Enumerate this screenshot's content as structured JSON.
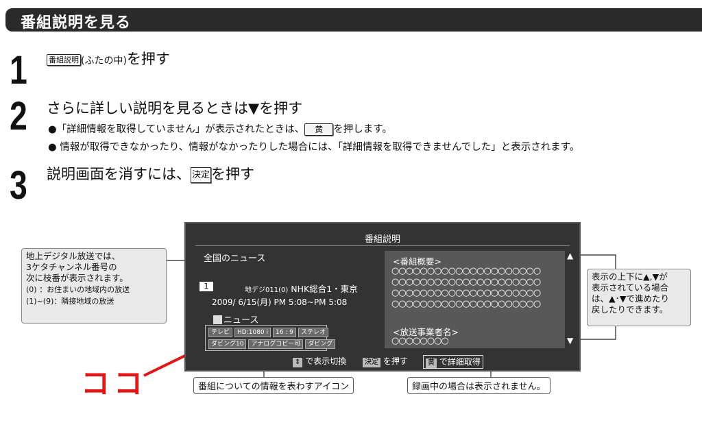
{
  "header": {
    "title": "番組説明を見る"
  },
  "steps": [
    {
      "num": "1",
      "key": "番組説明",
      "paren": "(ふたの中)",
      "text": "を押す"
    },
    {
      "num": "2",
      "text": "さらに詳しい説明を見るときは▼を押す"
    },
    {
      "num": "3",
      "text_before": "説明画面を消すには、",
      "key": "決定",
      "text_after": "を押す"
    }
  ],
  "bullets": [
    {
      "before": "●「詳細情報を取得していません」が表示されたときは、",
      "key": "黄",
      "after": "を押します。"
    },
    {
      "text": "● 情報が取得できなかったり、情報がなかったりした場合には、「詳細情報を取得できませんでした」と表示されます。"
    }
  ],
  "screen": {
    "title": "番組説明",
    "program_title": "全国のニュース",
    "channel_number": "1",
    "channel_small": "地デジ011(0)",
    "channel_name": "NHK総合1・東京",
    "datetime": "2009/  6/15(月) PM 5:08~PM 5:08",
    "genre": "ニュース",
    "icons_row1": [
      "テレビ",
      "HD:1080 i",
      "16 : 9",
      "ステレオ"
    ],
    "icons_row2": [
      "ダビング10",
      "アナログコピー可",
      "ダビング"
    ],
    "summary_label": "<番組概要>",
    "summary_circles": [
      "○○○○○○○○○○○○○○○○○○○○○",
      "○○○○○○○○○○○○○○○○○○○○○",
      "○○○○○○○○○○○○○○○○○○○○○",
      "○○○○○○○○○○○○○○○○○○○○○"
    ],
    "broadcaster_label": "<放送事業者名>",
    "broadcaster_circles": "○○○○○○○○",
    "arrow_up": "▲",
    "arrow_down": "▼",
    "footer_toggle": "で表示切換",
    "footer_decide_key": "決定",
    "footer_decide": "を押す",
    "footer_yellow_key": "黄",
    "footer_detail": "で詳細取得"
  },
  "callouts": {
    "left_main": "地上デジタル放送では、3ケタチャンネル番号の次に枝番が表示されます。",
    "left_line1": "地上デジタル放送では、",
    "left_line2": "3ケタチャンネル番号の",
    "left_line3": "次に枝番が表示されます。",
    "left_sub1": "(0)     ：お住まいの地域内の放送",
    "left_sub2": "(1)~(9)：隣接地域の放送",
    "right_line1": "表示の上下に▲,▼が",
    "right_line2": "表示されている場合",
    "right_line3": "は、▲･▼で進めたり",
    "right_line4": "戻したりできます。",
    "bottom_icons": "番組についての情報を表わすアイコン",
    "bottom_record": "録画中の場合は表示されません。",
    "koko": "ココ"
  },
  "colors": {
    "accent_red": "#e51515",
    "header_bg": "#2a2a2a",
    "screen_bg": "#333333"
  }
}
